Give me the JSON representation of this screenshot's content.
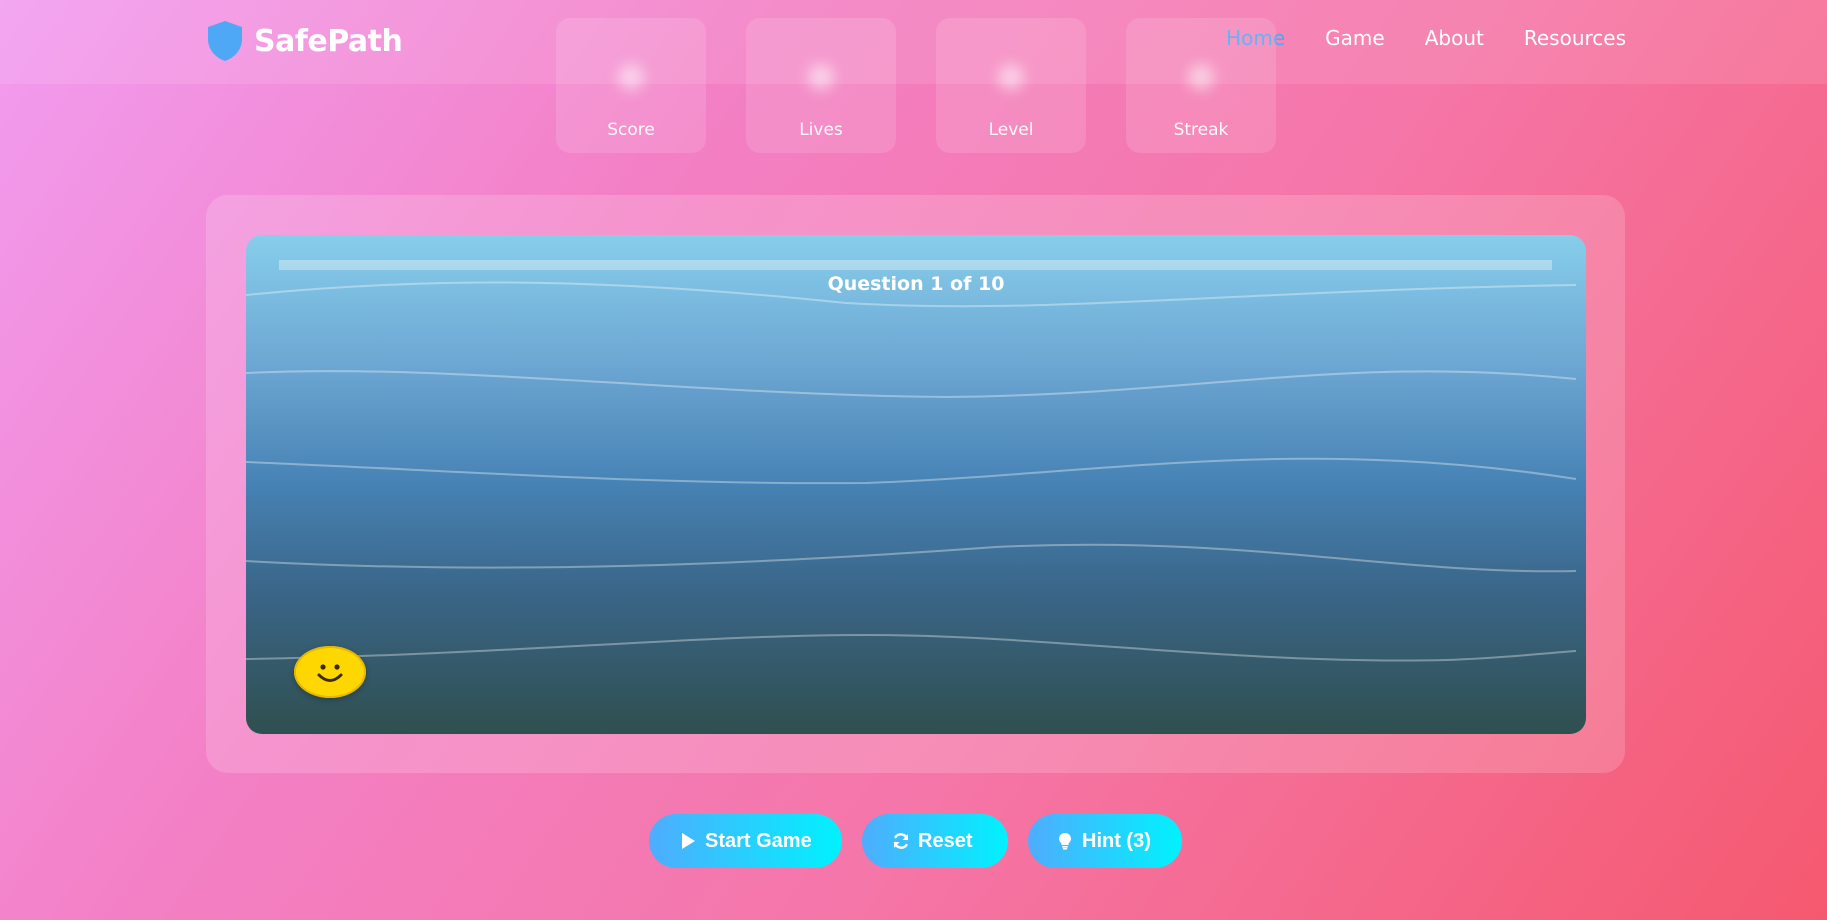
{
  "brand": {
    "name": "SafePath",
    "icon": "shield-icon",
    "icon_color": "#4ea8f5"
  },
  "nav": {
    "items": [
      "Home",
      "Game",
      "About",
      "Resources"
    ],
    "active": "Home",
    "active_color": "#4ea8f5"
  },
  "stats": [
    {
      "label": "Score"
    },
    {
      "label": "Lives"
    },
    {
      "label": "Level"
    },
    {
      "label": "Streak"
    }
  ],
  "game": {
    "question_text": "Question 1 of 10",
    "player_icon": "smiley-face",
    "player_glyph": "☺",
    "player_color": "#ffd700"
  },
  "controls": {
    "start_label": "Start Game",
    "start_icon": "play-icon",
    "reset_label": "Reset",
    "reset_icon": "refresh-icon",
    "hint_label": "Hint (3)",
    "hint_icon": "lightbulb-icon"
  },
  "colors": {
    "button_gradient_start": "#4facfe",
    "button_gradient_end": "#00f2fe"
  }
}
